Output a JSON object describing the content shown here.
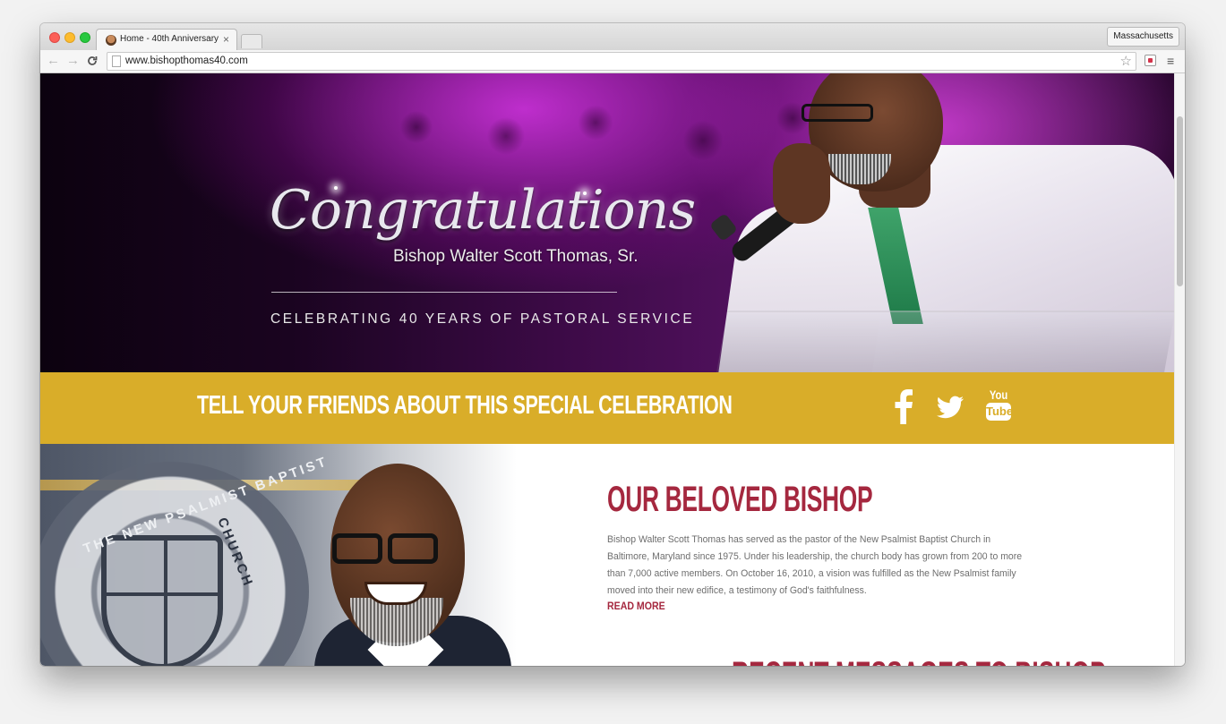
{
  "browser": {
    "tab_title": "Home - 40th Anniversary",
    "tab_close": "×",
    "profile_name": "Massachusetts",
    "url": "www.bishopthomas40.com",
    "nav_back": "←",
    "nav_forward": "→",
    "nav_reload": "C",
    "star": "☆",
    "menu": "≡"
  },
  "hero": {
    "script_title": "Congratulations",
    "name": "Bishop Walter Scott Thomas, Sr.",
    "subtitle": "CELEBRATING 40 YEARS OF PASTORAL SERVICE"
  },
  "share_band": {
    "text": "TELL YOUR FRIENDS ABOUT THIS SPECIAL CELEBRATION",
    "icons": [
      "facebook-icon",
      "twitter-icon",
      "youtube-icon"
    ],
    "youtube_you": "You",
    "youtube_tube": "Tube",
    "background_color": "#d9ad29"
  },
  "about": {
    "heading": "OUR BELOVED BISHOP",
    "body": "Bishop Walter Scott Thomas has served as the pastor of the New Psalmist Baptist Church in Baltimore, Maryland since 1975. Under his leadership, the church body has grown from 200 to more than 7,000 active members. On October 16, 2010, a vision was fulfilled as the New Psalmist family moved into their new edifice, a testimony of God's faithfulness.",
    "read_more": "READ MORE",
    "seal_text_top": "THE NEW PSALMIST BAPTIST",
    "seal_text_right": "CHURCH",
    "accent_color": "#a5283f"
  },
  "recent": {
    "heading": "RECENT MESSAGES TO BISHOP"
  }
}
